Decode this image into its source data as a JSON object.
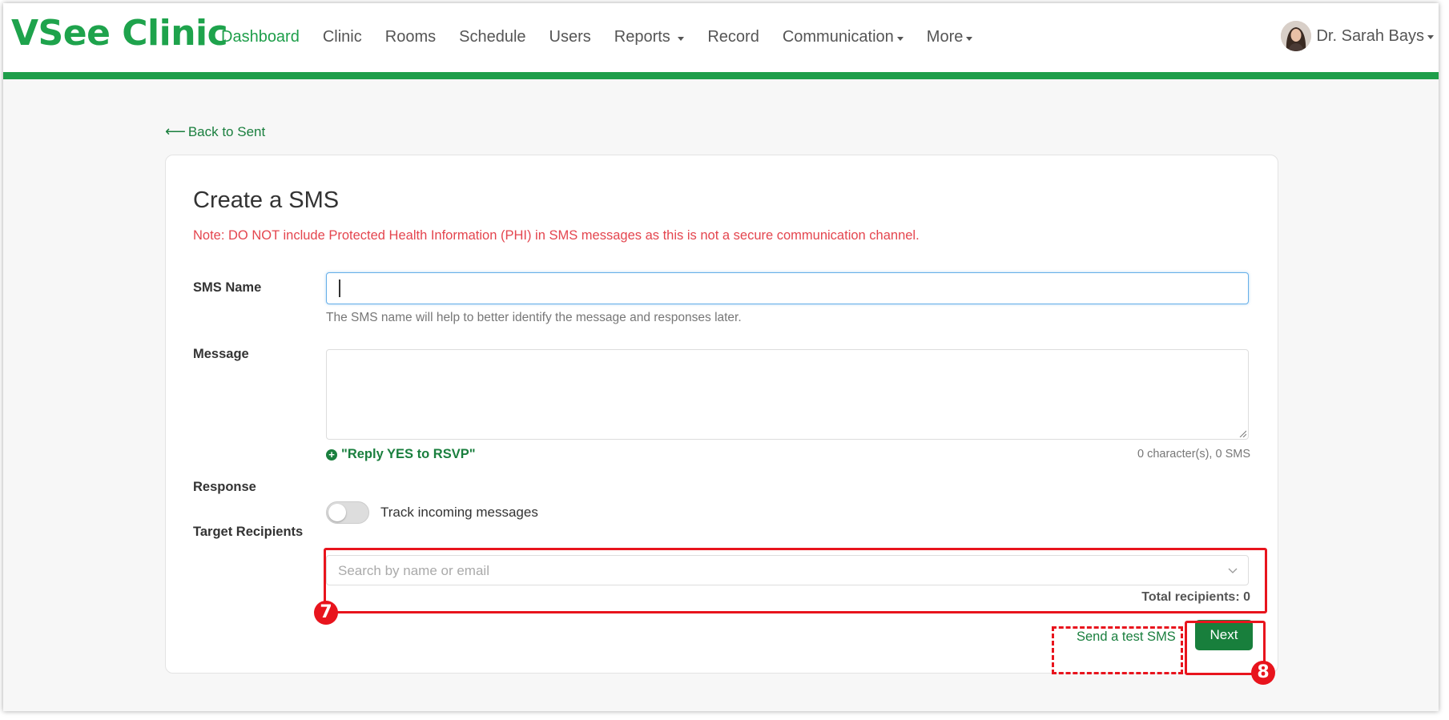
{
  "brand": {
    "logo": "VSee Clinic",
    "accent": "#1e9e4a",
    "annotation_color": "#e8141d"
  },
  "nav": {
    "items": [
      {
        "label": "Dashboard",
        "active": true,
        "dropdown": false
      },
      {
        "label": "Clinic",
        "active": false,
        "dropdown": false
      },
      {
        "label": "Rooms",
        "active": false,
        "dropdown": false
      },
      {
        "label": "Schedule",
        "active": false,
        "dropdown": false
      },
      {
        "label": "Users",
        "active": false,
        "dropdown": false
      },
      {
        "label": "Reports",
        "active": false,
        "dropdown": true
      },
      {
        "label": "Record",
        "active": false,
        "dropdown": false
      },
      {
        "label": "Communication",
        "active": false,
        "dropdown": true
      },
      {
        "label": "More",
        "active": false,
        "dropdown": true
      }
    ]
  },
  "user": {
    "name": "Dr. Sarah Bays",
    "avatar_icon": "avatar-icon"
  },
  "back_link": "Back to Sent",
  "form": {
    "title": "Create a SMS",
    "note": "Note: DO NOT include Protected Health Information (PHI) in SMS messages as this is not a secure communication channel.",
    "sms_name": {
      "label": "SMS Name",
      "value": "",
      "help": "The SMS name will help to better identify the message and responses later."
    },
    "message": {
      "label": "Message",
      "value": "",
      "reply_link": "\"Reply YES to RSVP\"",
      "counter": "0 character(s), 0 SMS"
    },
    "response": {
      "label": "Response",
      "toggle_label": "Track incoming messages",
      "toggle_on": false
    },
    "recipients": {
      "label": "Target Recipients",
      "placeholder": "Search by name or email",
      "total": "Total recipients: 0"
    },
    "actions": {
      "test_sms": "Send a test SMS",
      "next": "Next"
    }
  },
  "annotations": {
    "step7": "7",
    "step8": "8"
  }
}
